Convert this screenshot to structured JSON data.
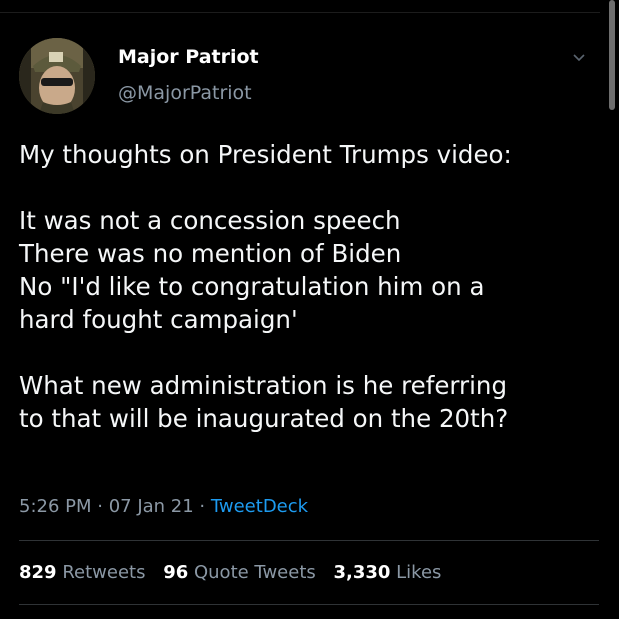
{
  "user": {
    "display_name": "Major Patriot",
    "handle": "@MajorPatriot"
  },
  "tweet": {
    "lines": [
      "My thoughts on President Trumps video:",
      "",
      "It was not a concession speech",
      "There was no mention of Biden",
      "No \"I'd like to congratulation him on a",
      "hard fought campaign'",
      "",
      "What new administration is he referring",
      "to that will be inaugurated on the 20th?"
    ]
  },
  "meta": {
    "time": "5:26 PM",
    "separator": " · ",
    "date": "07 Jan 21",
    "source": "TweetDeck"
  },
  "stats": {
    "retweets_count": "829",
    "retweets_label": "Retweets",
    "quote_count": "96",
    "quote_label": "Quote Tweets",
    "likes_count": "3,330",
    "likes_label": "Likes"
  },
  "icons": {
    "menu": "chevron-down-icon"
  },
  "colors": {
    "background": "#000000",
    "text": "#f5f7f8",
    "secondary": "#8b98a5",
    "link": "#1d9bf0"
  }
}
